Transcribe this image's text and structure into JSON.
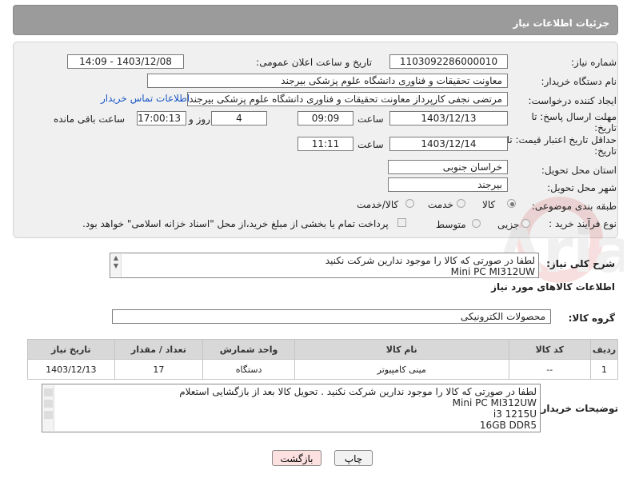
{
  "header": {
    "title": "جزئیات اطلاعات نیاز"
  },
  "labels": {
    "need_number": "شماره نیاز:",
    "announce_datetime": "تاریخ و ساعت اعلان عمومی:",
    "buyer_org": "نام دستگاه خریدار:",
    "creator": "ایجاد کننده درخواست:",
    "contact_link": "اطلاعات تماس خریدار",
    "deadline_send_line1": "مهلت ارسال پاسخ: تا",
    "deadline_send_line2": "تاریخ:",
    "validity_line1": "حداقل تاریخ اعتبار قیمت: تا",
    "validity_line2": "تاریخ:",
    "time": "ساعت",
    "day_and": "روز و",
    "remaining": "ساعت باقی مانده",
    "province": "استان محل تحویل:",
    "city": "شهر محل تحویل:",
    "category": "طبقه بندی موضوعی:",
    "purchase_type": "نوع فرآیند خرید :",
    "desc": "شرح کلی نیاز:",
    "goods_info": "اطلاعات کالاهای مورد نیاز",
    "goods_group": "گروه کالا:",
    "buyer_notes": "توضیحات خریدار:"
  },
  "values": {
    "need_number": "1103092286000010",
    "announce_datetime": "1403/12/08 - 14:09",
    "buyer_org": "معاونت تحقیقات و فناوری دانشگاه علوم پزشکی بیرجند",
    "creator": "مرتضی نجفی کارپرداز معاونت تحقیقات و فناوری دانشگاه علوم پزشکی بیرجند",
    "deadline_date": "1403/12/13",
    "deadline_time": "09:09",
    "days": "4",
    "remaining_time": "17:00:13",
    "validity_date": "1403/12/14",
    "validity_time": "11:11",
    "province": "خراسان جنوبی",
    "city": "بیرجند",
    "goods_group": "محصولات الکترونیکی"
  },
  "category_options": {
    "goods": "کالا",
    "service": "خدمت",
    "goods_service": "کالا/خدمت"
  },
  "purchase_options": {
    "small": "جزیی",
    "medium": "متوسط"
  },
  "payment_note": "پرداخت تمام یا بخشی از مبلغ خرید،از محل \"اسناد خزانه اسلامی\" خواهد بود.",
  "desc_lines": [
    "لطفا در صورتی که کالا را موجود ندارین شرکت نکنید",
    "Mini PC MI312UW"
  ],
  "table": {
    "headers": [
      "ردیف",
      "کد کالا",
      "نام کالا",
      "واحد شمارش",
      "تعداد / مقدار",
      "تاریخ نیاز"
    ],
    "rows": [
      [
        "1",
        "--",
        "مینی کامپیوتر",
        "دستگاه",
        "17",
        "1403/12/13"
      ]
    ]
  },
  "notes_lines": [
    "لطفا در صورتی که کالا را موجود ندارین شرکت نکنید . تحویل کالا بعد از بازگشایی استعلام",
    "Mini PC MI312UW",
    "i3 1215U",
    "16GB DDR5"
  ],
  "buttons": {
    "print": "چاپ",
    "back": "بازگشت"
  },
  "watermark_text": "AriaTender.neT",
  "colors": {
    "header_bg": "#9b9b9b",
    "link": "#1a57c7",
    "back_button_bg": "#fde0e0"
  }
}
